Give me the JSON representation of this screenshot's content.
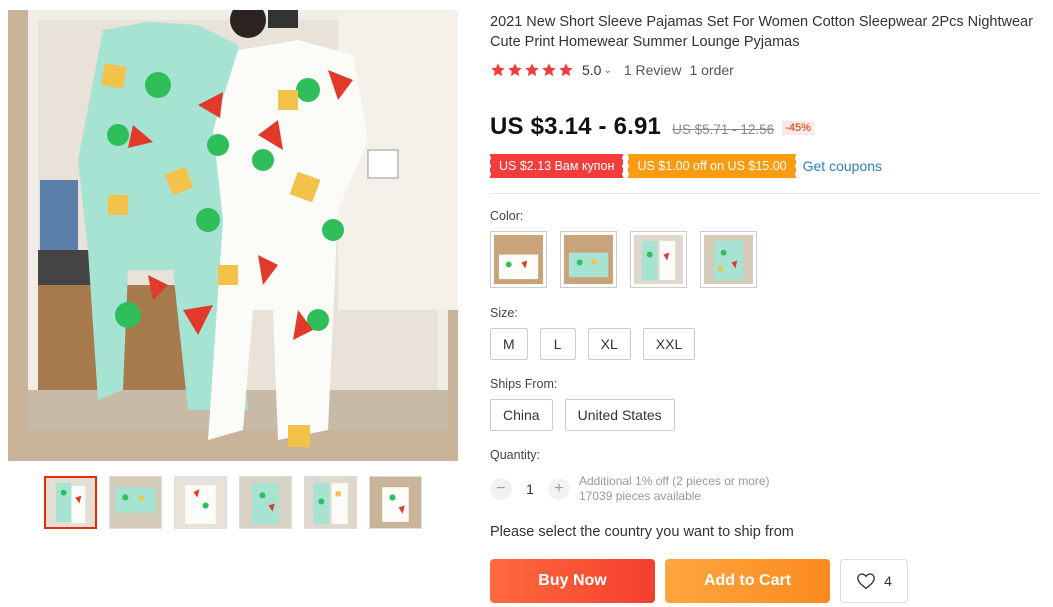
{
  "product": {
    "title": "2021 New Short Sleeve Pajamas Set For Women Cotton Sleepwear 2Pcs Nightwear Cute Print Homewear Summer Lounge Pyjamas"
  },
  "rating": {
    "value": "5.0",
    "stars": 5,
    "reviews": "1 Review",
    "orders": "1 order"
  },
  "price": {
    "current": "US $3.14 - 6.91",
    "original": "US $5.71 - 12.56",
    "discount": "-45%"
  },
  "coupons": {
    "coupon1": "US $2.13 Вам купон",
    "coupon2": "US $1.00 off on US $15.00",
    "get_coupons": "Get coupons"
  },
  "color": {
    "label": "Color:",
    "options": [
      "color-option-1",
      "color-option-2",
      "color-option-3",
      "color-option-4"
    ]
  },
  "size": {
    "label": "Size:",
    "options": [
      "M",
      "L",
      "XL",
      "XXL"
    ]
  },
  "ships_from": {
    "label": "Ships From:",
    "options": [
      "China",
      "United States"
    ]
  },
  "quantity": {
    "label": "Quantity:",
    "value": "1",
    "minus": "−",
    "plus": "+",
    "note": "Additional 1% off (2 pieces or more)",
    "available": "17039 pieces available"
  },
  "ship_note": "Please select the country you want to ship from",
  "actions": {
    "buy_now": "Buy Now",
    "add_to_cart": "Add to Cart",
    "wishlist_count": "4"
  },
  "gallery": {
    "thumbnail_count": 6,
    "active_index": 0
  },
  "colors": {
    "accent_red": "#e62e04",
    "star": "#f33d3d",
    "buy_button": "#f43f2f",
    "cart_button": "#fb8a1e",
    "link": "#2e7fb8",
    "pajama_mint": "#a6e3d3",
    "shape_green": "#2fbe5a",
    "shape_red": "#e23a2a",
    "shape_yellow": "#f2c24b"
  }
}
